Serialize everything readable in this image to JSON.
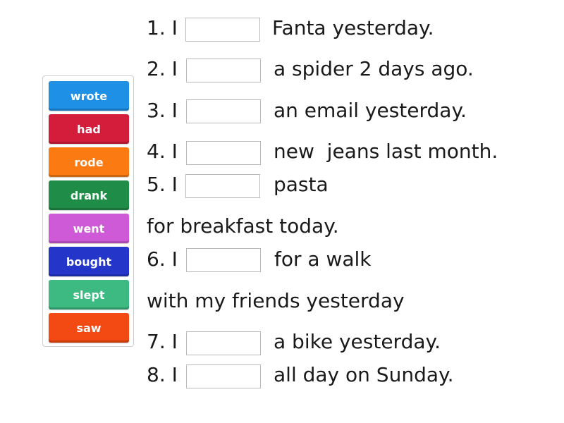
{
  "word_bank": {
    "tiles": [
      {
        "label": "wrote",
        "color": "#1e90e6"
      },
      {
        "label": "had",
        "color": "#d41d3a"
      },
      {
        "label": "rode",
        "color": "#fb7a12"
      },
      {
        "label": "drank",
        "color": "#1f8c48"
      },
      {
        "label": "went",
        "color": "#cf5ad8"
      },
      {
        "label": "bought",
        "color": "#2336c9"
      },
      {
        "label": "slept",
        "color": "#3dba82"
      },
      {
        "label": "saw",
        "color": "#f24a12"
      }
    ]
  },
  "sentences": [
    {
      "prefix": "1. I",
      "blank_value": "",
      "suffix": "Fanta yesterday."
    },
    {
      "prefix": "2. I",
      "blank_value": "",
      "suffix": "a spider 2 days ago."
    },
    {
      "prefix": "3. I",
      "blank_value": "",
      "suffix": "an email yesterday."
    },
    {
      "prefix": "4. I",
      "blank_value": "",
      "suffix": "new  jeans last month."
    },
    {
      "prefix": "5. I",
      "blank_value": "",
      "suffix": "pasta",
      "continuation": "for breakfast today."
    },
    {
      "prefix": "6. I",
      "blank_value": "",
      "suffix": "for a walk",
      "continuation": "with my friends yesterday"
    },
    {
      "prefix": "7. I",
      "blank_value": "",
      "suffix": "a bike yesterday."
    },
    {
      "prefix": "8. I",
      "blank_value": "",
      "suffix": "all day on Sunday."
    }
  ]
}
